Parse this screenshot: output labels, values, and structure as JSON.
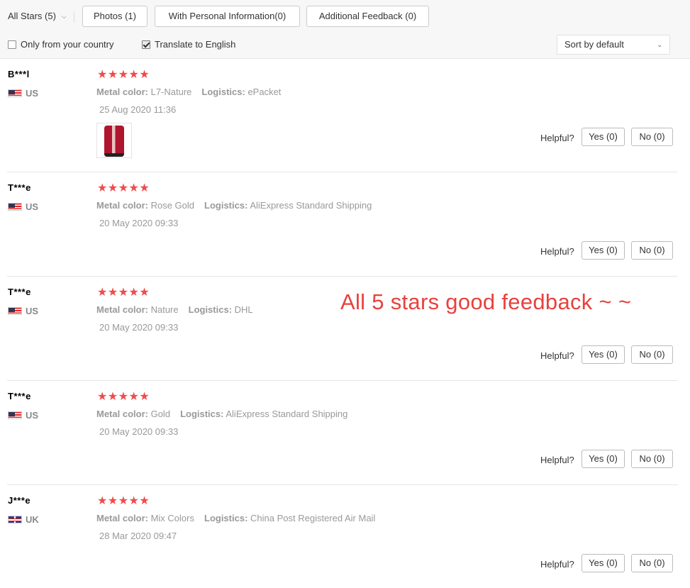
{
  "filters": {
    "star_select_label": "All Stars (5)",
    "star_select_icon": "chevron-down-icon",
    "buttons": {
      "photos": "Photos (1)",
      "personal_info": "With Personal Information(0)",
      "additional_feedback": "Additional Feedback (0)"
    },
    "only_country_label": "Only from your country",
    "only_country_checked": false,
    "translate_label": "Translate to English",
    "translate_checked": true,
    "sort_value": "Sort by default"
  },
  "reviews": [
    {
      "user": "B***l",
      "country": "US",
      "rating_stars": 5,
      "stars_text": "★★★★★",
      "attr_label": "Metal color:",
      "attr_value": "L7-Nature",
      "logistics_label": "Logistics:",
      "logistics_value": "ePacket",
      "date": "25 Aug 2020 11:36",
      "has_photo": true,
      "helpful_label": "Helpful?",
      "yes_label": "Yes (0)",
      "no_label": "No (0)"
    },
    {
      "user": "T***e",
      "country": "US",
      "rating_stars": 5,
      "stars_text": "★★★★★",
      "attr_label": "Metal color:",
      "attr_value": "Rose Gold",
      "logistics_label": "Logistics:",
      "logistics_value": "AliExpress Standard Shipping",
      "date": "20 May 2020 09:33",
      "has_photo": false,
      "helpful_label": "Helpful?",
      "yes_label": "Yes (0)",
      "no_label": "No (0)"
    },
    {
      "user": "T***e",
      "country": "US",
      "rating_stars": 5,
      "stars_text": "★★★★★",
      "attr_label": "Metal color:",
      "attr_value": "Nature",
      "logistics_label": "Logistics:",
      "logistics_value": "DHL",
      "date": "20 May 2020 09:33",
      "has_photo": false,
      "helpful_label": "Helpful?",
      "yes_label": "Yes (0)",
      "no_label": "No (0)"
    },
    {
      "user": "T***e",
      "country": "US",
      "rating_stars": 5,
      "stars_text": "★★★★★",
      "attr_label": "Metal color:",
      "attr_value": "Gold",
      "logistics_label": "Logistics:",
      "logistics_value": "AliExpress Standard Shipping",
      "date": "20 May 2020 09:33",
      "has_photo": false,
      "helpful_label": "Helpful?",
      "yes_label": "Yes (0)",
      "no_label": "No (0)"
    },
    {
      "user": "J***e",
      "country": "UK",
      "rating_stars": 5,
      "stars_text": "★★★★★",
      "attr_label": "Metal color:",
      "attr_value": "Mix Colors",
      "logistics_label": "Logistics:",
      "logistics_value": "China Post Registered Air Mail",
      "date": "28 Mar 2020 09:47",
      "has_photo": false,
      "helpful_label": "Helpful?",
      "yes_label": "Yes (0)",
      "no_label": "No (0)"
    }
  ],
  "overlay_caption": "All 5 stars good feedback ~ ~",
  "colors": {
    "star": "#f04b4b",
    "caption": "#e8413e",
    "filter_bg": "#f7f7f7",
    "muted_text": "#999999"
  }
}
